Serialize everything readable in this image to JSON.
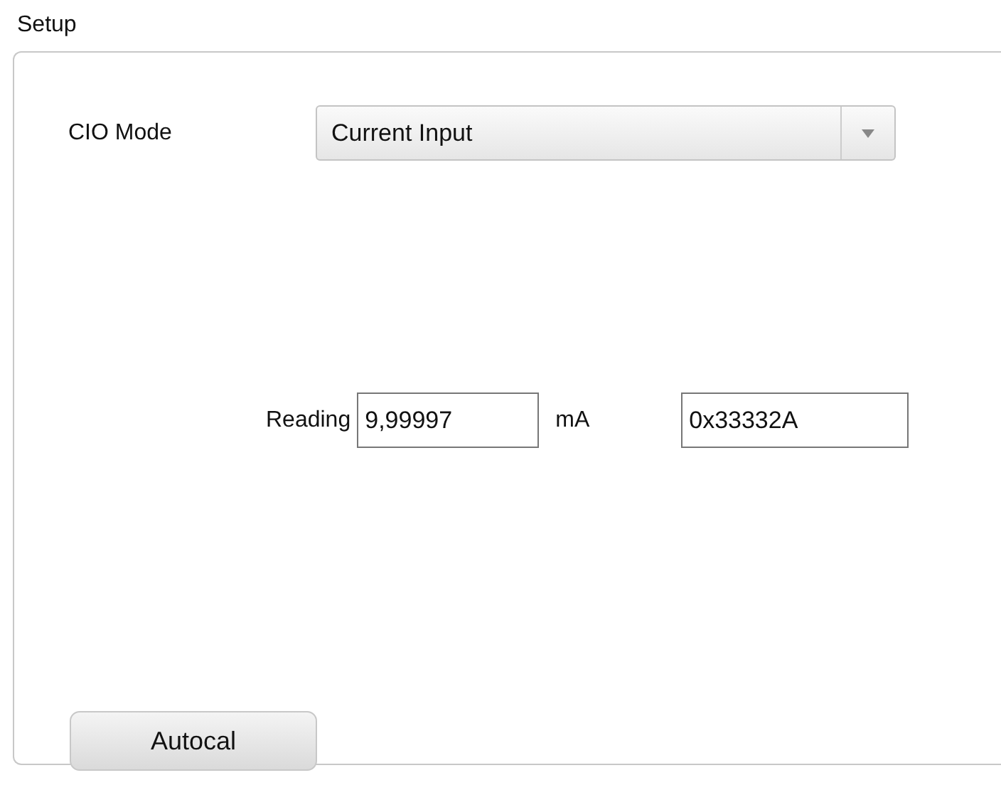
{
  "group": {
    "title": "Setup"
  },
  "mode": {
    "label": "CIO Mode",
    "value": "Current Input"
  },
  "reading": {
    "label": "Reading",
    "value": "9,99997",
    "unit": "mA",
    "raw": "0x33332A"
  },
  "buttons": [
    "Autocal"
  ]
}
